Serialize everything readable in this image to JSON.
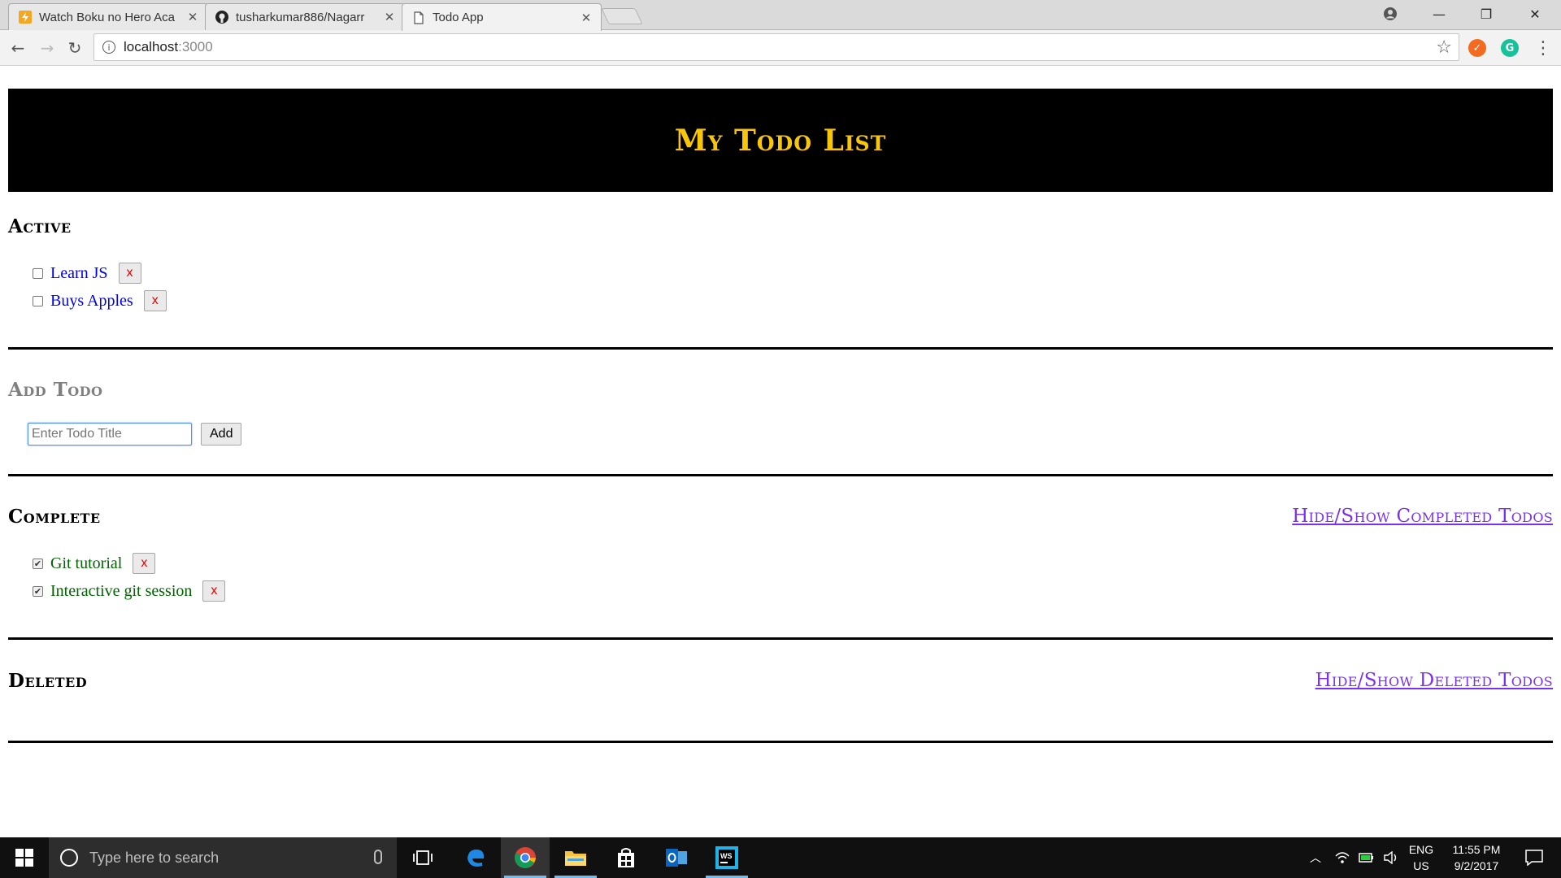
{
  "browser": {
    "tabs": [
      {
        "title": "Watch Boku no Hero Aca",
        "icon": "lightning-favicon-icon",
        "active": false
      },
      {
        "title": "tusharkumar886/Nagarr",
        "icon": "github-icon",
        "active": false
      },
      {
        "title": "Todo App",
        "icon": "page-icon",
        "active": true
      }
    ],
    "address": {
      "host": "localhost",
      "port": ":3000"
    }
  },
  "app": {
    "title": "My Todo List",
    "active": {
      "heading": "Active",
      "items": [
        {
          "label": "Learn JS",
          "checked": false,
          "delete_label": "x"
        },
        {
          "label": "Buys Apples",
          "checked": false,
          "delete_label": "x"
        }
      ]
    },
    "add": {
      "heading": "Add Todo",
      "placeholder": "Enter Todo Title",
      "button_label": "Add"
    },
    "complete": {
      "heading": "Complete",
      "toggle_label": "Hide/Show Completed Todos",
      "items": [
        {
          "label": "Git tutorial",
          "checked": true,
          "delete_label": "x"
        },
        {
          "label": "Interactive git session",
          "checked": true,
          "delete_label": "x"
        }
      ]
    },
    "deleted": {
      "heading": "Deleted",
      "toggle_label": "Hide/Show Deleted Todos"
    }
  },
  "taskbar": {
    "search_placeholder": "Type here to search",
    "language": "ENG",
    "region": "US",
    "time": "11:55 PM",
    "date": "9/2/2017"
  },
  "colors": {
    "title_yellow": "#f7c60a",
    "active_blue": "#0000ee",
    "complete_green": "#006400",
    "link_purple": "#7b2ff0",
    "delete_red": "#e00000"
  }
}
